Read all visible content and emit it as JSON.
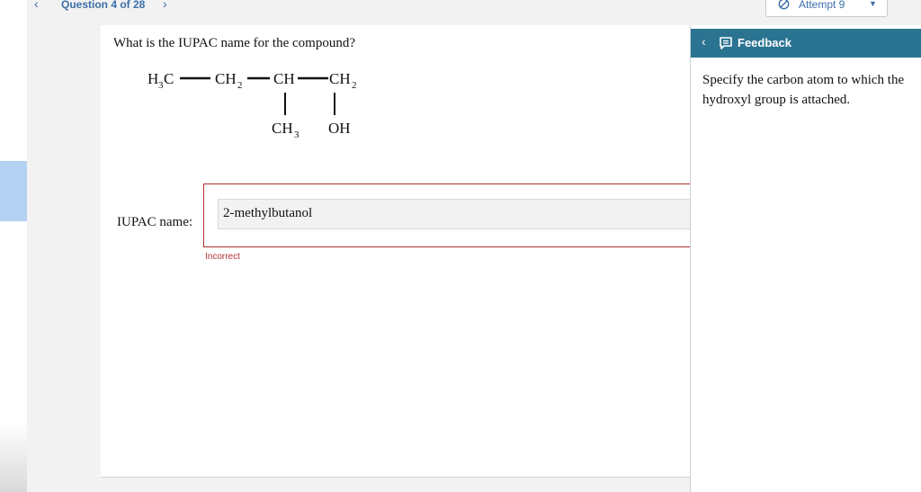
{
  "nav": {
    "prev_icon": "chevron-left-icon",
    "title": "Question 4 of 28",
    "next_icon": "chevron-right-icon"
  },
  "attempt": {
    "icon": "no-entry-icon",
    "label": "Attempt 9",
    "caret_icon": "caret-down-icon"
  },
  "question": {
    "prompt": "What is the IUPAC name for the compound?",
    "structure": {
      "main_chain": [
        "H",
        "3",
        "C",
        "CH",
        "2",
        "CH",
        "CH",
        "2"
      ],
      "branch_1": [
        "CH",
        "3"
      ],
      "branch_2": "OH"
    },
    "answer_label": "IUPAC name:",
    "answer_value": "2-methylbutanol",
    "status": "Incorrect"
  },
  "feedback": {
    "collapse_icon": "chevron-left-icon",
    "icon": "feedback-icon",
    "title": "Feedback",
    "text": "Specify the carbon atom to which the hydroxyl group is attached."
  },
  "colors": {
    "link": "#3d6fa8",
    "feedback_header": "#2b7491",
    "error": "#b03030",
    "sidebar_highlight": "#b3d2f2"
  }
}
